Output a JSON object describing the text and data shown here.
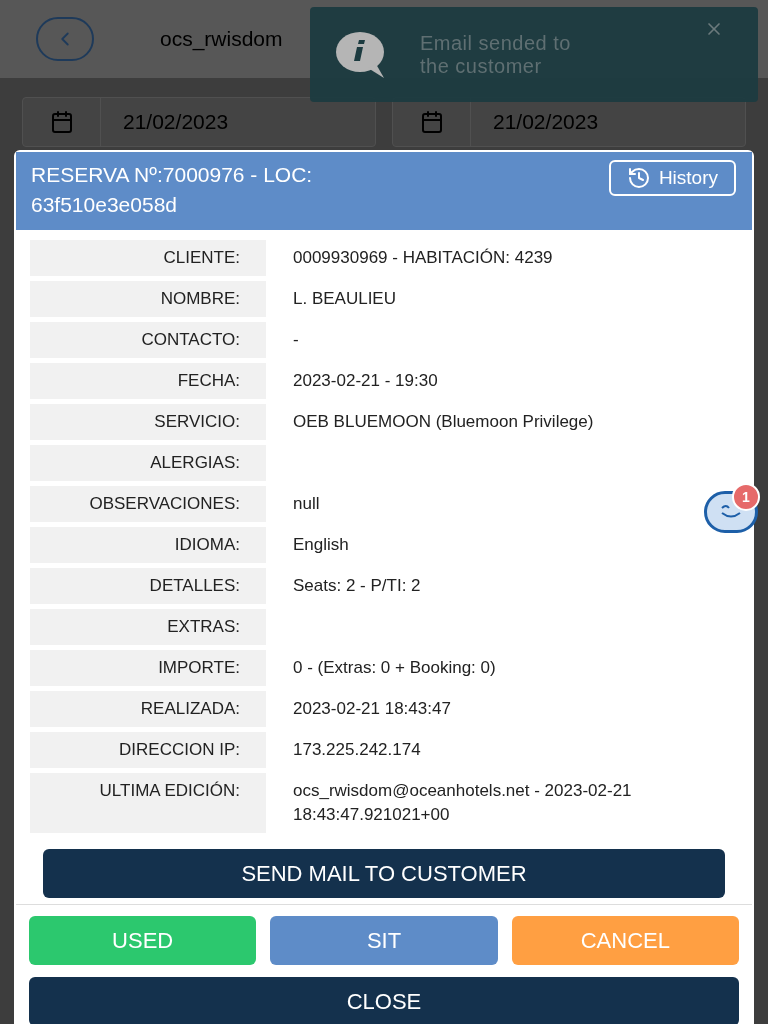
{
  "header": {
    "user": "ocs_rwisdom"
  },
  "date_filters": [
    {
      "value": "21/02/2023"
    },
    {
      "value": "21/02/2023"
    }
  ],
  "toast": {
    "message": "Email sended to the customer"
  },
  "modal": {
    "title": "RESERVA Nº:7000976 - LOC: 63f510e3e058d",
    "history_button": "History",
    "rows": [
      {
        "label": "CLIENTE:",
        "value": "0009930969 - HABITACIÓN: 4239"
      },
      {
        "label": "NOMBRE:",
        "value": "L. BEAULIEU"
      },
      {
        "label": "CONTACTO:",
        "value": "-"
      },
      {
        "label": "FECHA:",
        "value": "2023-02-21 - 19:30"
      },
      {
        "label": "SERVICIO:",
        "value": "OEB BLUEMOON (Bluemoon Privilege)"
      },
      {
        "label": "ALERGIAS:"
      },
      {
        "label": "OBSERVACIONES:",
        "value": "null"
      },
      {
        "label": "IDIOMA:",
        "value": "English"
      },
      {
        "label": "DETALLES:",
        "value": "Seats: 2 - P/TI: 2"
      },
      {
        "label": "EXTRAS:"
      },
      {
        "label": "IMPORTE:",
        "value": "0 - (Extras: 0 + Booking: 0)"
      },
      {
        "label": "REALIZADA:",
        "value": "2023-02-21 18:43:47"
      },
      {
        "label": "DIRECCION IP:",
        "value": "173.225.242.174"
      },
      {
        "label": "ULTIMA EDICIÓN:",
        "value": "ocs_rwisdom@oceanhotels.net - 2023-02-21 18:43:47.921021+00"
      }
    ],
    "send_button": "SEND MAIL TO CUSTOMER",
    "actions": [
      {
        "label": "USED",
        "kind": "used"
      },
      {
        "label": "SIT",
        "kind": "sit"
      },
      {
        "label": "CANCEL",
        "kind": "cancel"
      }
    ],
    "close_button": "CLOSE"
  },
  "chat_widget": {
    "badge": "1"
  }
}
